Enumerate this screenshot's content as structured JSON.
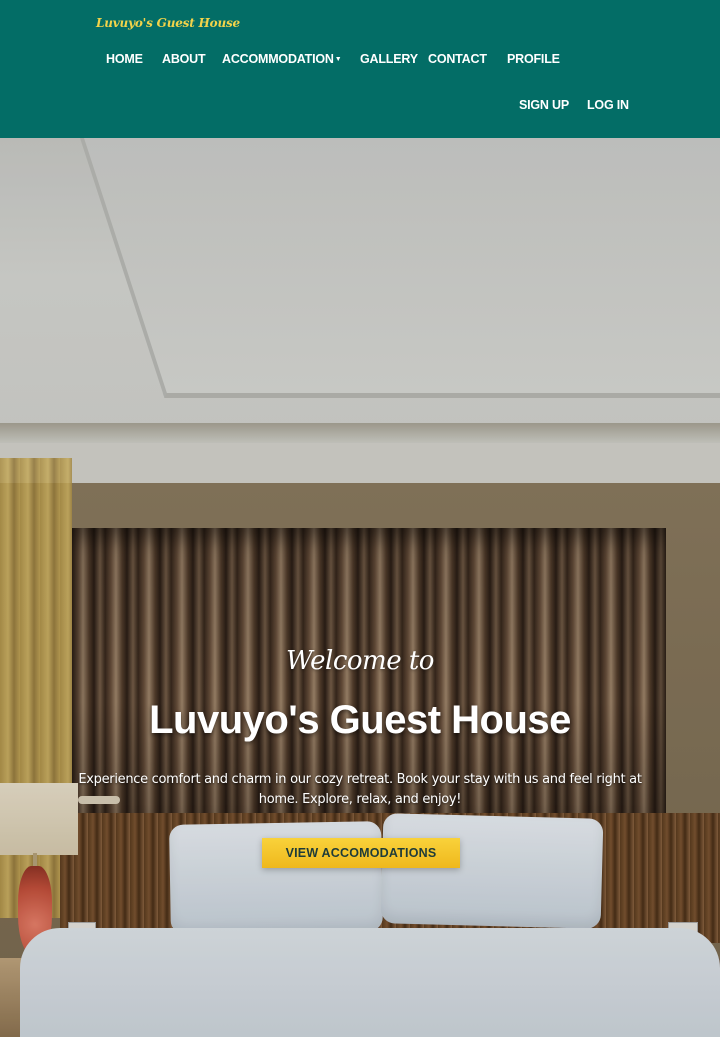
{
  "brand": {
    "name": "Luvuyo's Guest House"
  },
  "nav": {
    "items": [
      {
        "label": "HOME"
      },
      {
        "label": "ABOUT"
      },
      {
        "label": "ACCOMMODATION"
      },
      {
        "label": "GALLERY"
      },
      {
        "label": "CONTACT"
      },
      {
        "label": "PROFILE"
      }
    ],
    "auth": [
      {
        "label": "SIGN UP"
      },
      {
        "label": "LOG IN"
      }
    ]
  },
  "hero": {
    "welcome": "Welcome to",
    "title": "Luvuyo's Guest House",
    "description": "Experience comfort and charm in our cozy retreat. Book your stay with us and feel right at home. Explore, relax, and enjoy!",
    "cta_label": "VIEW ACCOMODATIONS"
  },
  "colors": {
    "header_bg": "#036d66",
    "brand_text": "#f2d34a",
    "cta_bg": "#f5c52a",
    "cta_text": "#1e3b39"
  },
  "icons": {
    "dropdown": "caret-down-icon"
  }
}
